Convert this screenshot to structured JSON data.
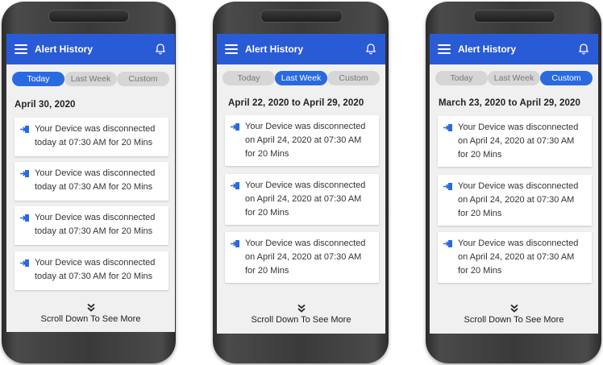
{
  "colors": {
    "accent": "#2a5bd7",
    "active_tab": "#2a6ae0",
    "inactive_tab": "#d6d6d6"
  },
  "phones": [
    {
      "app_title": "Alert History",
      "tabs": [
        "Today",
        "Last Week",
        "Custom"
      ],
      "active_tab": 0,
      "date_range": "April 30, 2020",
      "alerts": [
        {
          "line1": "Your Device was disconnected",
          "line2": "today at 07:30 AM for 20 Mins"
        },
        {
          "line1": "Your Device was disconnected",
          "line2": "today at 07:30 AM for 20 Mins"
        },
        {
          "line1": "Your Device was disconnected",
          "line2": "today at 07:30 AM for 20 Mins"
        },
        {
          "line1": "Your Device was disconnected",
          "line2": "today at 07:30 AM for 20 Mins"
        }
      ],
      "scroll_label": "Scroll Down To See More"
    },
    {
      "app_title": "Alert History",
      "tabs": [
        "Today",
        "Last Week",
        "Custom"
      ],
      "active_tab": 1,
      "date_range": "April 22, 2020 to April 29, 2020",
      "alerts": [
        {
          "line1": "Your Device was disconnected",
          "line2": "on April 24, 2020 at 07:30 AM",
          "line3": "for 20 Mins"
        },
        {
          "line1": "Your Device was disconnected",
          "line2": "on April 24, 2020 at 07:30 AM",
          "line3": "for 20 Mins"
        },
        {
          "line1": "Your Device was disconnected",
          "line2": "on April 24, 2020 at 07:30 AM",
          "line3": "for 20 Mins"
        }
      ],
      "scroll_label": "Scroll Down To See More"
    },
    {
      "app_title": "Alert History",
      "tabs": [
        "Today",
        "Last Week",
        "Custom"
      ],
      "active_tab": 2,
      "date_range": "March 23, 2020 to April 29, 2020",
      "alerts": [
        {
          "line1": "Your Device was disconnected",
          "line2": "on April 24, 2020 at 07:30 AM",
          "line3": "for 20 Mins"
        },
        {
          "line1": "Your Device was disconnected",
          "line2": "on April 24, 2020 at 07:30 AM",
          "line3": "for 20 Mins"
        },
        {
          "line1": "Your Device was disconnected",
          "line2": "on April 24, 2020 at 07:30 AM",
          "line3": "for 20 Mins"
        }
      ],
      "scroll_label": "Scroll Down To See More"
    }
  ]
}
